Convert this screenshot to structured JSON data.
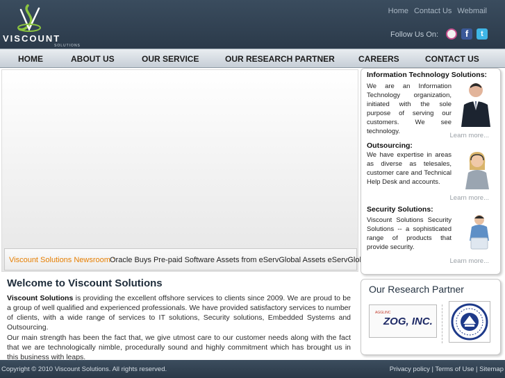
{
  "brand": {
    "name": "VISCOUNT",
    "tagline": "SOLUTIONS"
  },
  "toplinks": [
    "Home",
    "Contact Us",
    "Webmail"
  ],
  "follow_label": "Follow Us On:",
  "social": [
    "rss-icon",
    "facebook-icon",
    "twitter-icon"
  ],
  "nav": [
    "HOME",
    "ABOUT US",
    "OUR SERVICE",
    "OUR RESEARCH PARTNER",
    "CAREERS",
    "CONTACT US"
  ],
  "news": {
    "label": "Viscount Solutions Newsroom :",
    "text": "Oracle Buys Pre-paid Software Assets from eServGlobal Assets  eServGlobal."
  },
  "welcome": {
    "title": "Welcome to Viscount Solutions",
    "p1_lead": "Viscount Solutions",
    "p1_rest": " is providing the excellent offshore services to clients since 2009. We are proud to be a group of well qualified and experienced professionals. We have provided satisfactory services to number of clients, with a wide range of services to IT solutions, Security solutions, Embedded Systems and Outsourcing.",
    "p2": "Our main strength has been the fact that, we give utmost care to our customer needs along with the fact that we are technologically nimble, procedurally sound and highly commitment which has brought us in this business with leaps."
  },
  "services": [
    {
      "title": "Information Technology Solutions:",
      "desc": "We are an Information Technology organization, initiated with the sole purpose of serving our customers. We see technology.",
      "link": "Learn more..."
    },
    {
      "title": "Outsourcing:",
      "desc": "We have expertise in areas as diverse as telesales, customer care and Technical Help Desk and accounts.",
      "link": "Learn more..."
    },
    {
      "title": "Security Solutions:",
      "desc": "Viscount Solutions Security Solutions -- a sophisticated range of products that provide security.",
      "link": "Learn more..."
    }
  ],
  "partners": {
    "title": "Our Research Partner",
    "zog_text": "ZOG, INC.",
    "zog_small": "AGGLINC"
  },
  "footer": {
    "copyright": "Copyright © 2010 Viscount Solutions. All rights reserved.",
    "links": [
      "Privacy policy",
      "Terms of Use",
      "Sitemap"
    ]
  },
  "colors": {
    "header": "#2b3a4a",
    "accent": "#e67e00",
    "logo_green": "#8cc63f"
  }
}
